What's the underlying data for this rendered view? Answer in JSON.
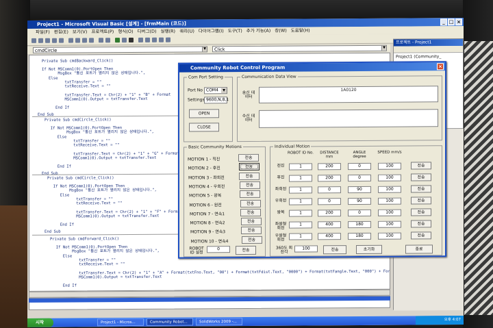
{
  "vb": {
    "title": "Project1 - Microsoft Visual Basic [설계] - [frmMain (코드)]",
    "menu": [
      "파일(F)",
      "편집(E)",
      "보기(V)",
      "프로젝트(P)",
      "형식(O)",
      "디버그(D)",
      "실행(R)",
      "쿼리(U)",
      "다이어그램(I)",
      "도구(T)",
      "추가 기능(A)",
      "창(W)",
      "도움말(H)"
    ],
    "object_combo": "cmdCircle",
    "proc_combo": "Click",
    "code_lines": [
      "Private Sub cmdBackward_Click()",
      "If Not MSComm1(0).PortOpen Then",
      "    MsgBox \"통신 포트가 열리지 않은 상태입니다.\", ",
      "Else",
      "    txtTransfer = \"\"",
      "    txtReceive.Text = \"\"",
      "    txtTransfer.Text = Chr(2) + \"1\" + \"B\" + Format",
      "    MSComm1(0).Output = txtTransfer.Text",
      "End If",
      "End Sub",
      "Private Sub cmdCircle_Click()",
      "  If Not MSComm1(0).PortOpen Then",
      "      MsgBox \"통신 포트가 열리지 않은 상태입니다.\", ",
      "  Else",
      "      txtTransfer = \"\"",
      "      txtReceive.Text = \"\"",
      "      txtTransfer.Text = Chr(2) + \"1\" + \"G\" + Format",
      "      MSComm1(0).Output = txtTransfer.Text",
      "  End If",
      "End Sub",
      "Private Sub cmdCircle_Click()",
      "  If Not MSComm1(0).PortOpen Then",
      "      MsgBox \"통신 포트가 열리지 않은 상태입니다.\", ",
      "  Else",
      "      txtTransfer = \"\"",
      "      txtReceive.Text = \"\"",
      "      txtTransfer.Text = Chr(2) + \"1\" + \"F\" + Format",
      "      MSComm1(0).Output = txtTransfer.Text",
      "  End If",
      "End Sub",
      "Private Sub cmdForward_Click()",
      "  If Not MSComm1(0).PortOpen Then",
      "      MsgBox \"통신 포트가 열리지 않은 상태입니다.\", ",
      "  Else",
      "      txtTransfer = \"\"",
      "      txtReceive.Text = \"\"",
      "      txtTransfer.Text = Chr(2) + \"1\" + \"A\" + Format(txtFno.Text, \"00\") + Format(txtFdist.Text, \"0000\") + Format(txtFangle.Text, \"000\") + Format",
      "      MSComm1(0).Output = txtTransfer.Text",
      "  End If",
      "End Sub"
    ],
    "project_title": "프로젝트 - Project1",
    "project_item": "Project1 (Community_"
  },
  "taskbar": {
    "start": "시작",
    "tasks": [
      "Project1 - Micros...",
      "Community Robot...",
      "SolidWorks 2009 -..."
    ],
    "clock": "오후 4:07"
  },
  "dialog": {
    "title": "Community Robot Control Program",
    "com_port": {
      "legend": "Com Port Setting",
      "port_label": "Port No",
      "port_value": "COM4",
      "settings_label": "Settings",
      "settings_value": "9600,N,8,1",
      "open": "OPEN",
      "close": "CLOSE"
    },
    "comm_view": {
      "legend": "Communication  Data View",
      "send_label": "송신 데이터",
      "send_value": "1A0120",
      "recv_label": "수신 데이터"
    },
    "basic": {
      "legend": "Basic Community Motions",
      "motions": [
        "MOTION 1 - 직진",
        "MOTION 2 - 후진",
        "MOTION 3 - 좌회전",
        "MOTION 4 - 우회전",
        "MOTION 5 - 왕복",
        "MOTION 6 - 원전",
        "MOTION 7 - 연속1",
        "MOTION 8 - 연속2",
        "MOTION 9 - 연속3",
        "MOTION 10 - 연속4"
      ],
      "send": "전송",
      "robot_id_label": "ROBOT ID 설정",
      "robot_id_value": "0"
    },
    "individual": {
      "legend": "Individual Motion",
      "headers": [
        "ROBOT ID No.",
        "DISTANCE mm",
        "ANGLE degree",
        "SPEED mm/s"
      ],
      "rows": [
        {
          "label": "전진",
          "values": [
            "1",
            "200",
            "0",
            "100"
          ]
        },
        {
          "label": "후진",
          "values": [
            "1",
            "200",
            "0",
            "100"
          ]
        },
        {
          "label": "좌회전",
          "values": [
            "1",
            "0",
            "90",
            "100"
          ]
        },
        {
          "label": "우회전",
          "values": [
            "1",
            "0",
            "90",
            "100"
          ]
        },
        {
          "label": "왕복",
          "values": [
            "1",
            "200",
            "0",
            "100"
          ]
        },
        {
          "label": "좌원형 회전",
          "values": [
            "1",
            "400",
            "180",
            "100"
          ]
        },
        {
          "label": "우원형 회전",
          "values": [
            "1",
            "400",
            "180",
            "100"
          ]
        }
      ],
      "send": "전송",
      "rot_label": "360도 회전각",
      "rot_value": "100",
      "init": "초기화",
      "exit": "종료"
    }
  }
}
